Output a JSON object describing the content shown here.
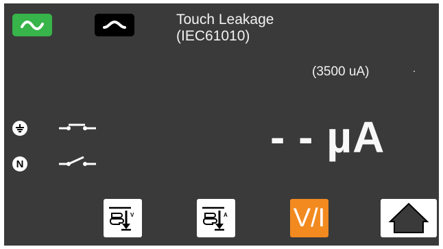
{
  "header": {
    "title_line1": "Touch Leakage",
    "title_line2": "(IEC61010)"
  },
  "range_label": "(3500 uA)",
  "reading": "- - µA",
  "indicators": {
    "earth_icon": "earth-symbol",
    "neutral_label": "N",
    "earth_switch": "closed",
    "neutral_switch": "open"
  },
  "toolbar": {
    "vi_label": "V/I",
    "hold_v_label": "V",
    "hold_a_label": "A"
  },
  "colors": {
    "screen_bg": "#3a3a3a",
    "ac_active": "#37b44a",
    "ac_inactive": "#000000",
    "vi_button": "#f28a20",
    "soft_button": "#ffffff"
  }
}
